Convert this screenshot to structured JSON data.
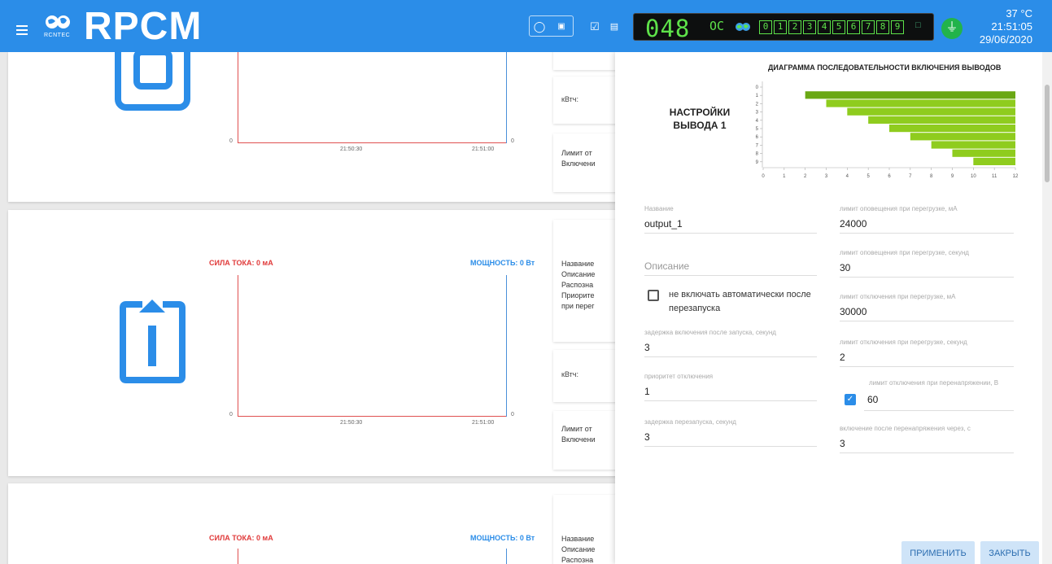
{
  "header": {
    "brand": "RPCM",
    "logo_small": "RCNTEC",
    "lcd_number": "048",
    "lcd_oc": "OC",
    "lcd_outputs": [
      "0",
      "1",
      "2",
      "3",
      "4",
      "5",
      "6",
      "7",
      "8",
      "9"
    ],
    "temperature": "37 °C",
    "time": "21:51:05",
    "date": "29/06/2020"
  },
  "cards": [
    {
      "current_label": "",
      "power_label": "",
      "time_ticks": [
        "21:50:30",
        "21:51:00"
      ],
      "zero_left": "0",
      "zero_right": "0",
      "info_top": [
        "кВтч:"
      ],
      "info_bottom": [
        "Лимит от",
        "Включени"
      ]
    },
    {
      "current_label": "СИЛА ТОКА: 0 мА",
      "power_label": "МОЩНОСТЬ: 0 Вт",
      "time_ticks": [
        "21:50:30",
        "21:51:00"
      ],
      "zero_left": "0",
      "zero_right": "0",
      "info_main": [
        "Название",
        "Описание",
        "Распозна",
        "Приорите",
        "при перег"
      ],
      "info_top": [
        "кВтч:"
      ],
      "info_bottom": [
        "Лимит от",
        "Включени"
      ]
    },
    {
      "current_label": "СИЛА ТОКА: 0 мА",
      "power_label": "МОЩНОСТЬ: 0 Вт",
      "info_main": [
        "Название",
        "Описание",
        "Распозна"
      ]
    }
  ],
  "panel": {
    "title": "НАСТРОЙКИ ВЫВОДА 1",
    "diagram_title": "ДИАГРАММА ПОСЛЕДОВАТЕЛЬНОСТИ ВКЛЮЧЕНИЯ ВЫВОДОВ",
    "name_label": "Название",
    "name_value": "output_1",
    "description_placeholder": "Описание",
    "no_autostart_label": "не включать автоматически после перезапуска",
    "start_delay_label": "задержка включения после запуска, секунд",
    "start_delay_value": "3",
    "shutdown_priority_label": "приоритет отключения",
    "shutdown_priority_value": "1",
    "restart_delay_label": "задержка перезапуска, секунд",
    "restart_delay_value": "3",
    "overload_alert_ma_label": "лимит оповещения при перегрузке, мА",
    "overload_alert_ma_value": "24000",
    "overload_alert_sec_label": "лимит оповещения при перегрузке, секунд",
    "overload_alert_sec_value": "30",
    "overload_off_ma_label": "лимит отключения при перегрузке, мА",
    "overload_off_ma_value": "30000",
    "overload_off_sec_label": "лимит отключения при перегрузке, секунд",
    "overload_off_sec_value": "2",
    "overvoltage_off_label": "лимит отключения при перенапряжении, В",
    "overvoltage_off_value": "60",
    "overvoltage_on_label": "включение после перенапряжения через, с",
    "overvoltage_on_value": "3",
    "apply_label": "ПРИМЕНИТЬ",
    "close_label": "ЗАКРЫТЬ"
  },
  "chart_data": {
    "type": "bar",
    "orientation": "horizontal",
    "title": "ДИАГРАММА ПОСЛЕДОВАТЕЛЬНОСТИ ВКЛЮЧЕНИЯ ВЫВОДОВ",
    "categories": [
      "0",
      "1",
      "2",
      "3",
      "4",
      "5",
      "6",
      "7",
      "8",
      "9"
    ],
    "series": [
      {
        "start": [
          12,
          2,
          3,
          4,
          5,
          6,
          7,
          8,
          9,
          10
        ],
        "end": [
          12,
          12,
          12,
          12,
          12,
          12,
          12,
          12,
          12,
          12
        ]
      }
    ],
    "highlight_category": "1",
    "xlim": [
      0,
      12
    ],
    "x_ticks": [
      "0",
      "1",
      "2",
      "3",
      "4",
      "5",
      "6",
      "7",
      "8",
      "9",
      "10",
      "11",
      "12"
    ],
    "colors": {
      "bar": "#8fcc1e",
      "highlight": "#6aa814"
    }
  }
}
